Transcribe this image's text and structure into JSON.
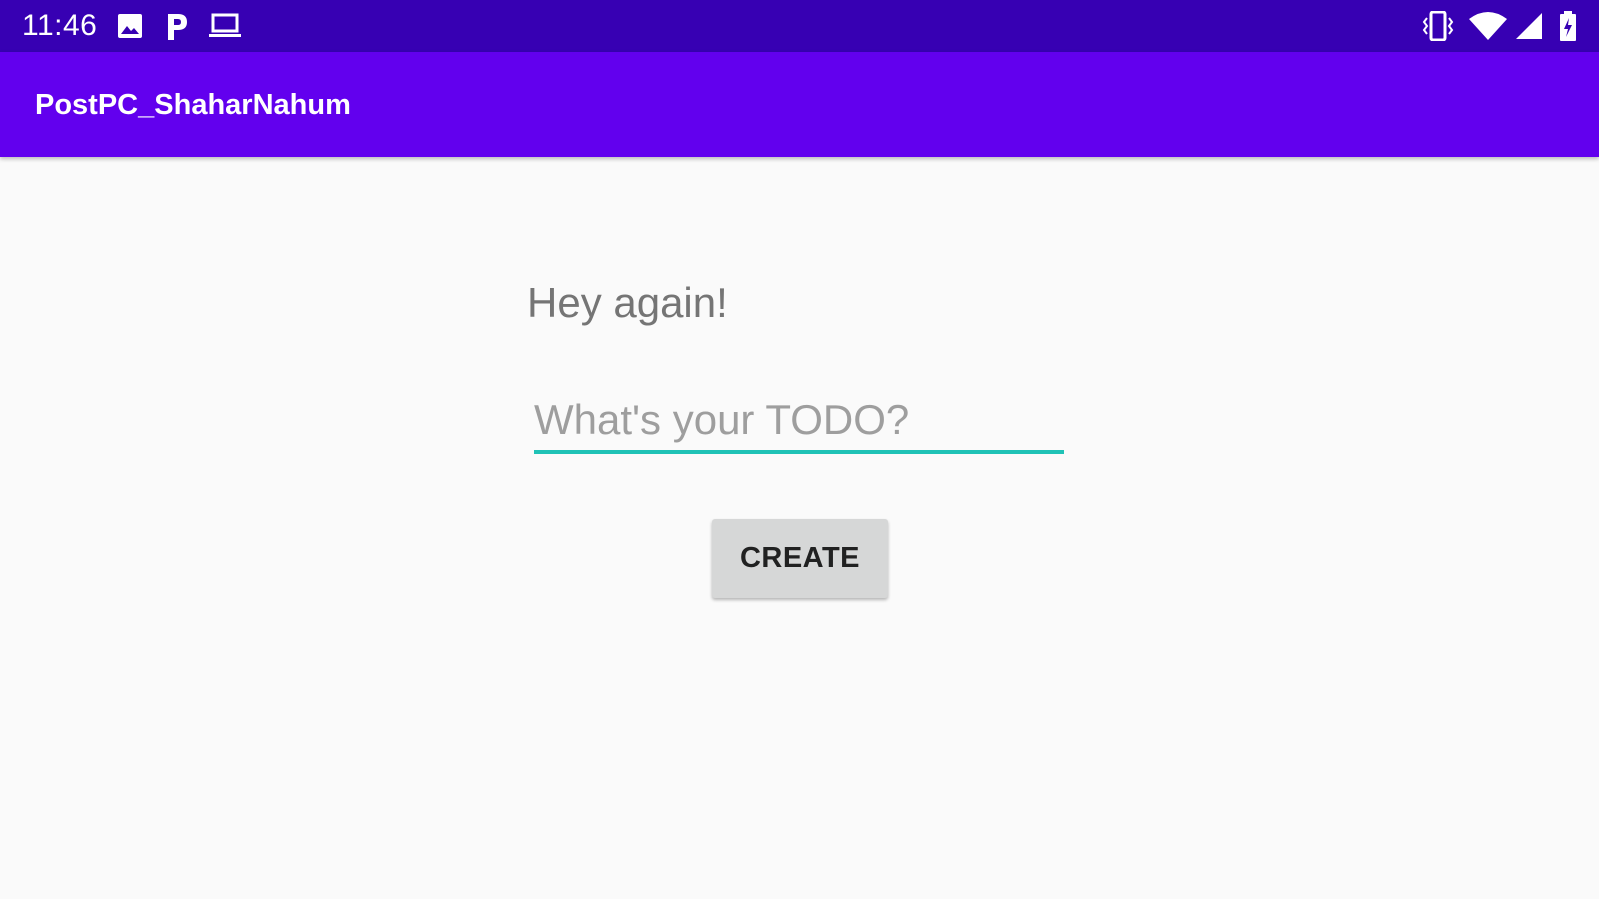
{
  "status_bar": {
    "time": "11:46",
    "background": "#3700b3",
    "left_icons": [
      "image-icon",
      "p-app-icon",
      "laptop-icon"
    ],
    "right_icons": [
      "vibrate-icon",
      "wifi-icon",
      "cell-signal-icon",
      "battery-charging-icon"
    ]
  },
  "app_bar": {
    "title": "PostPC_ShaharNahum",
    "background": "#6200ee"
  },
  "main": {
    "greeting": "Hey again!",
    "todo_input": {
      "value": "",
      "placeholder": "What's your TODO?",
      "underline_color": "#1fc2b6"
    },
    "create_button": {
      "label": "CREATE",
      "background": "#d6d7d7"
    }
  }
}
